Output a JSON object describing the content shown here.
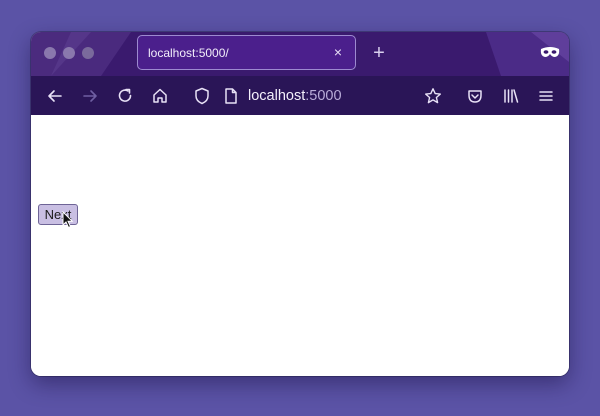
{
  "browser": {
    "tab": {
      "title": "localhost:5000/",
      "close_glyph": "×"
    },
    "new_tab_glyph": "+",
    "address": {
      "host": "localhost",
      "port": ":5000"
    },
    "icons": {
      "back": "arrow-left-icon",
      "forward": "arrow-right-icon",
      "reload": "reload-icon",
      "home": "home-icon",
      "tracking_protection": "shield-icon",
      "page_info": "page-icon",
      "bookmark": "star-icon",
      "pocket": "pocket-icon",
      "library": "library-icon",
      "menu": "hamburger-menu-icon",
      "private": "private-browsing-mask-icon"
    }
  },
  "page": {
    "next_button_label": "Next"
  },
  "colors": {
    "desktop": "#5b53a6",
    "titlebar": "#3a1a6e",
    "toolbar": "#2a1557",
    "tab_active": "#4b1f8c",
    "button_bg": "#c9bfe3"
  }
}
